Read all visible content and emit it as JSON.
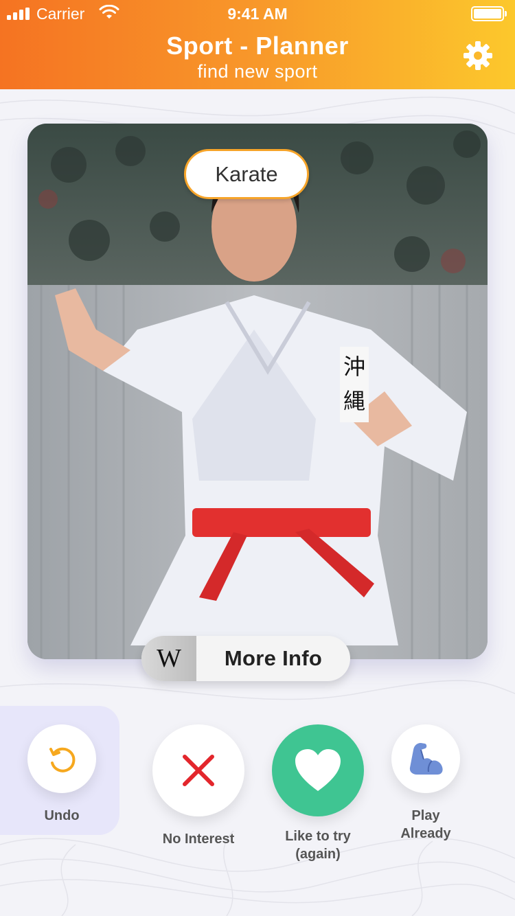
{
  "status_bar": {
    "carrier": "Carrier",
    "time": "9:41 AM"
  },
  "header": {
    "title": "Sport - Planner",
    "subtitle": "find new sport",
    "settings_icon": "gear-icon",
    "gradient_colors": [
      "#f57322",
      "#fcc82c"
    ]
  },
  "card": {
    "sport_name": "Karate",
    "image_subject": "karate-athlete-photo",
    "more_info": {
      "badge": "W",
      "label": "More Info"
    }
  },
  "actions": {
    "undo": {
      "label": "Undo",
      "icon": "undo-icon",
      "color": "#f6a81e"
    },
    "no_interest": {
      "label": "No Interest",
      "icon": "close-icon",
      "color": "#e3262c"
    },
    "like": {
      "label": "Like to try\n(again)",
      "icon": "heart-icon",
      "color": "#3fc592"
    },
    "play_already": {
      "label": "Play\nAlready",
      "icon": "flexed-bicep-icon",
      "color": "#6f8fd6"
    }
  },
  "colors": {
    "accent_outline": "#f6a429",
    "background": "#f3f3f8",
    "undo_panel": "#e7e6fa"
  }
}
